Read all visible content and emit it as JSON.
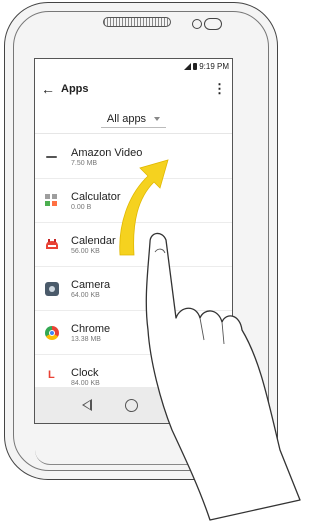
{
  "status": {
    "time": "9:19 PM"
  },
  "appbar": {
    "back_icon": "arrow-left-icon",
    "title": "Apps",
    "menu_icon": "more-vert-icon"
  },
  "filter": {
    "selected": "All apps"
  },
  "apps": [
    {
      "name": "Amazon Video",
      "size": "7.50 MB",
      "icon": "amazon-video-icon"
    },
    {
      "name": "Calculator",
      "size": "0.00 B",
      "icon": "calculator-icon"
    },
    {
      "name": "Calendar",
      "size": "56.00 KB",
      "icon": "calendar-icon"
    },
    {
      "name": "Camera",
      "size": "64.00 KB",
      "icon": "camera-icon"
    },
    {
      "name": "Chrome",
      "size": "13.38 MB",
      "icon": "chrome-icon"
    },
    {
      "name": "Clock",
      "size": "84.00 KB",
      "icon": "clock-icon"
    }
  ],
  "navbar": {
    "icons": [
      "back-triangle-icon",
      "home-circle-icon",
      "recents-square-icon"
    ]
  },
  "colors": {
    "arrow": "#f5d21f",
    "accent": "#222222"
  },
  "gesture": {
    "type": "swipe-up",
    "indicator": "yellow-curved-arrow"
  }
}
